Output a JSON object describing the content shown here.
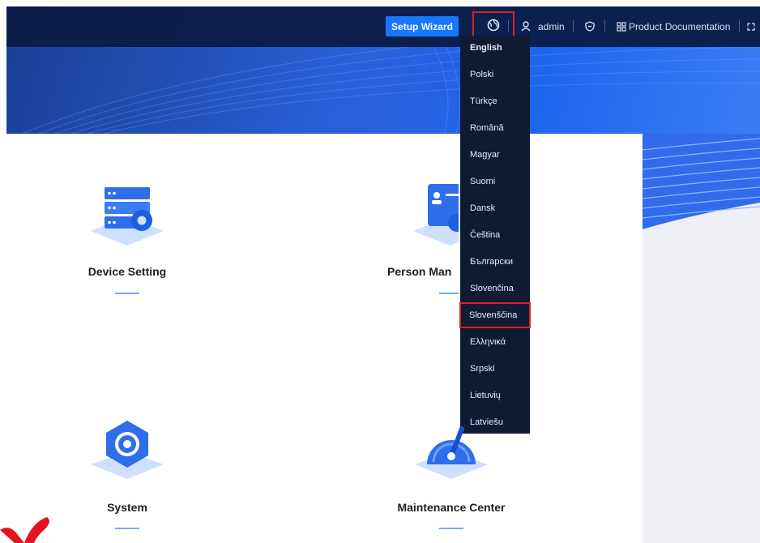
{
  "header": {
    "setup_wizard_label": "Setup Wizard",
    "user_name": "admin",
    "product_documentation_label": "Product Documentation",
    "language_icon": "globe-icon",
    "user_icon": "user-icon",
    "security_icon": "shield-icon",
    "documentation_icon": "grid-icon",
    "fullscreen_icon": "fullscreen-icon"
  },
  "language_menu": {
    "items": [
      {
        "label": "English"
      },
      {
        "label": "Polski"
      },
      {
        "label": "Türkçe"
      },
      {
        "label": "Română"
      },
      {
        "label": "Magyar"
      },
      {
        "label": "Suomi"
      },
      {
        "label": "Dansk"
      },
      {
        "label": "Čeština"
      },
      {
        "label": "Български"
      },
      {
        "label": "Slovenčina"
      },
      {
        "label": "Slovenščina"
      },
      {
        "label": "Ελληνικά"
      },
      {
        "label": "Srpski"
      },
      {
        "label": "Lietuvių"
      },
      {
        "label": "Latviešu"
      }
    ],
    "highlighted": "Slovenščina"
  },
  "cards": [
    {
      "title": "Device Setting",
      "icon": "device-setting-icon"
    },
    {
      "title": "Person Man",
      "icon": "person-management-icon"
    },
    {
      "title": "System",
      "icon": "system-gear-icon"
    },
    {
      "title": "Maintenance Center",
      "icon": "maintenance-gauge-icon"
    }
  ],
  "colors": {
    "topbar": "#0a1a42",
    "accent": "#1677ff",
    "dropdown": "#0f1a33",
    "highlight_border": "#e02020"
  }
}
